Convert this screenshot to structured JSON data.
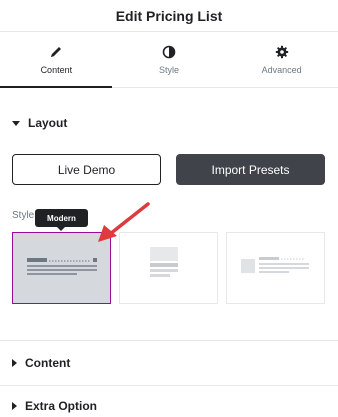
{
  "header": {
    "title": "Edit Pricing List"
  },
  "tabs": [
    {
      "label": "Content",
      "icon": "pencil-icon",
      "active": true
    },
    {
      "label": "Style",
      "icon": "contrast-icon",
      "active": false
    },
    {
      "label": "Advanced",
      "icon": "gear-icon",
      "active": false
    }
  ],
  "layout": {
    "title": "Layout",
    "live_demo_label": "Live Demo",
    "import_presets_label": "Import Presets",
    "style_label": "Style",
    "tooltip": "Modern",
    "presets": [
      {
        "name": "modern",
        "selected": true
      },
      {
        "name": "preset-2",
        "selected": false
      },
      {
        "name": "preset-3",
        "selected": false
      }
    ]
  },
  "sections": [
    {
      "title": "Content"
    },
    {
      "title": "Extra Option"
    }
  ],
  "colors": {
    "accent_selected_border": "#9b0a9b",
    "arrow": "#e0393e",
    "primary_button": "#404349"
  }
}
